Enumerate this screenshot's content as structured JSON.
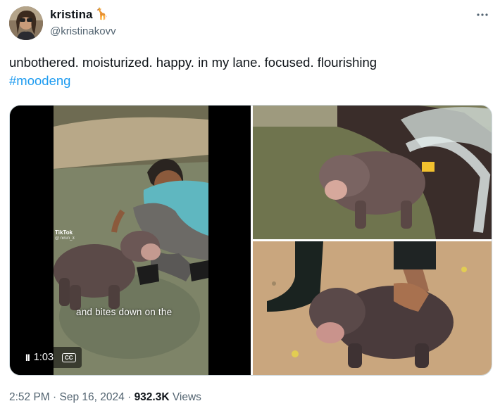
{
  "author": {
    "display_name": "kristina",
    "emoji": "🦒",
    "handle": "@kristinakovv"
  },
  "more_icon": "more-horizontal-icon",
  "tweet": {
    "text": "unbothered. moisturized. happy. in my lane. focused. flourishing",
    "hashtag": "#moodeng"
  },
  "video": {
    "caption": "and bites down on the",
    "watermark": "TikTok",
    "watermark_sub": "@ nirun_3",
    "time": "1:03",
    "pause_glyph": "II",
    "cc_label": "CC"
  },
  "meta": {
    "time": "2:52 PM",
    "separator": "·",
    "date": "Sep 16, 2024",
    "views_count": "932.3K",
    "views_label": "Views"
  },
  "colors": {
    "accent": "#1d9bf0",
    "secondary_text": "#536471"
  }
}
